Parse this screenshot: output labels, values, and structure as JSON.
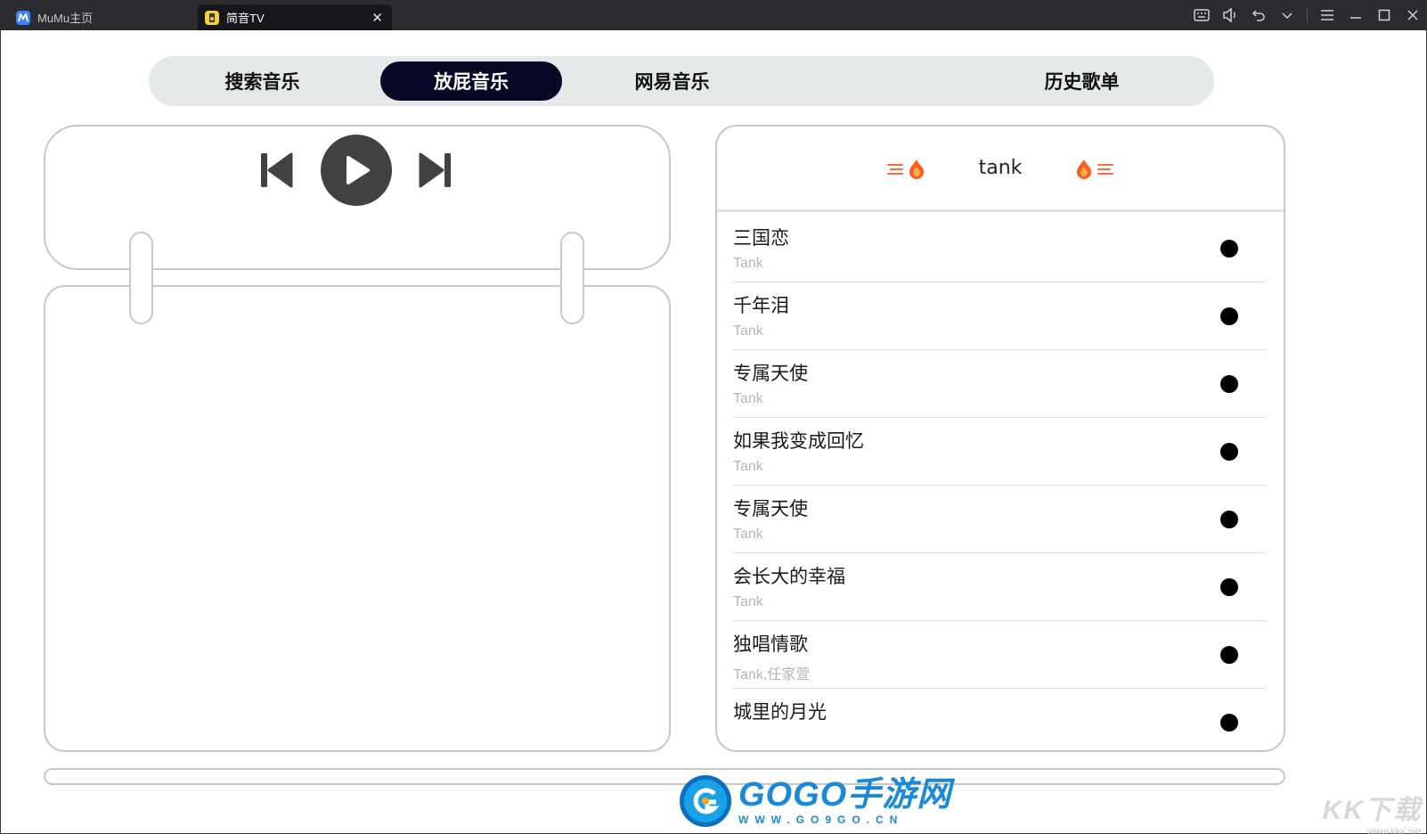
{
  "titlebar": {
    "tabs": [
      {
        "label": "MuMu主页",
        "icon": "mumu-logo-icon",
        "active": false
      },
      {
        "label": "简音TV",
        "icon": "app-logo-icon",
        "active": true
      }
    ],
    "close_glyph": "✕",
    "controls": [
      "keyboard-icon",
      "volume-icon",
      "undo-icon",
      "chevron-down-icon",
      "menu-icon",
      "minimize-icon",
      "maximize-icon",
      "close-icon"
    ]
  },
  "nav": {
    "items": [
      {
        "label": "搜索音乐",
        "active": false
      },
      {
        "label": "放屁音乐",
        "active": true
      },
      {
        "label": "网易音乐",
        "active": false
      },
      {
        "label": "历史歌单",
        "active": false
      }
    ]
  },
  "player": {
    "buttons": [
      "skip-previous-icon",
      "play-icon",
      "skip-next-icon"
    ]
  },
  "playlist": {
    "title": "tank",
    "songs": [
      {
        "name": "三国恋",
        "artist": "Tank"
      },
      {
        "name": "千年泪",
        "artist": "Tank"
      },
      {
        "name": "专属天使",
        "artist": "Tank"
      },
      {
        "name": "如果我变成回忆",
        "artist": "Tank"
      },
      {
        "name": "专属天使",
        "artist": "Tank"
      },
      {
        "name": "会长大的幸福",
        "artist": "Tank"
      },
      {
        "name": "独唱情歌",
        "artist": "Tank,任家萱"
      },
      {
        "name": "城里的月光",
        "artist": ""
      }
    ]
  },
  "progress": {
    "fraction": 0
  },
  "watermarks": {
    "gogo_main": "GOGO手游网",
    "gogo_url": "WWW.GO9GO.CN",
    "kk_main": "KK下载",
    "kk_url": "www.kkx.net"
  },
  "colors": {
    "titlebar_bg": "#2b2c30",
    "nav_bg": "#e6e9e9",
    "nav_active_bg": "#070726",
    "play_button_bg": "#424242",
    "panel_border": "#c8c8c8",
    "flame_orange": "#ff5a1f"
  }
}
